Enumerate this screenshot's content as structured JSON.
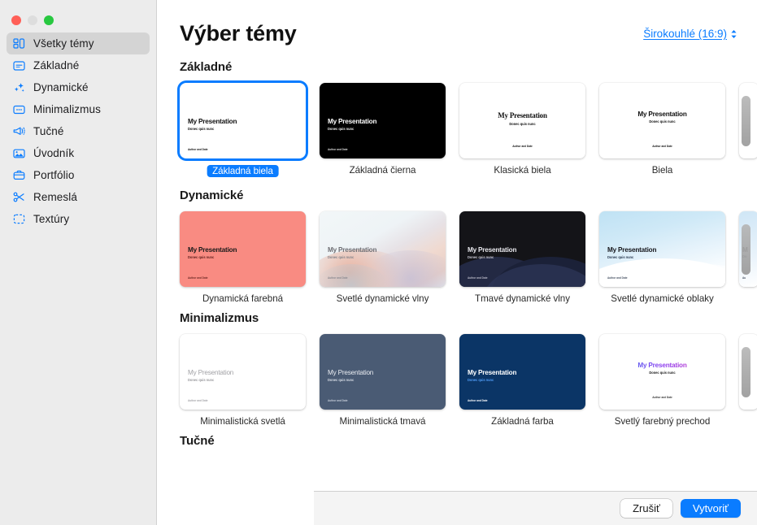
{
  "window": {
    "traffic": [
      "close",
      "minimize",
      "zoom"
    ]
  },
  "sidebar": {
    "items": [
      {
        "label": "Všetky témy",
        "icon": "grid-icon"
      },
      {
        "label": "Základné",
        "icon": "basic-slide-icon"
      },
      {
        "label": "Dynamické",
        "icon": "sparkles-icon"
      },
      {
        "label": "Minimalizmus",
        "icon": "minimal-slide-icon"
      },
      {
        "label": "Tučné",
        "icon": "megaphone-icon"
      },
      {
        "label": "Úvodník",
        "icon": "photo-icon"
      },
      {
        "label": "Portfólio",
        "icon": "briefcase-icon"
      },
      {
        "label": "Remeslá",
        "icon": "scissors-icon"
      },
      {
        "label": "Textúry",
        "icon": "dashed-frame-icon"
      }
    ],
    "selected_index": 0
  },
  "header": {
    "title": "Výber témy",
    "ratio_label": "Širokouhlé (16:9)"
  },
  "slide_text": {
    "title": "My Presentation",
    "subtitle": "Donec quis nunc",
    "author": "Author and Date"
  },
  "sections": [
    {
      "title": "Základné",
      "themes": [
        {
          "name": "Základná biela",
          "style": "basic-white",
          "selected": true
        },
        {
          "name": "Základná čierna",
          "style": "basic-black",
          "selected": false
        },
        {
          "name": "Klasická biela",
          "style": "classic-white",
          "selected": false
        },
        {
          "name": "Biela",
          "style": "white",
          "selected": false
        }
      ]
    },
    {
      "title": "Dynamické",
      "themes": [
        {
          "name": "Dynamická farebná",
          "style": "dyn-color",
          "selected": false
        },
        {
          "name": "Svetlé dynamické vlny",
          "style": "dyn-light-waves",
          "selected": false
        },
        {
          "name": "Tmavé dynamické vlny",
          "style": "dyn-dark-waves",
          "selected": false
        },
        {
          "name": "Svetlé dynamické oblaky",
          "style": "dyn-clouds",
          "selected": false
        }
      ]
    },
    {
      "title": "Minimalizmus",
      "themes": [
        {
          "name": "Minimalistická svetlá",
          "style": "min-light",
          "selected": false
        },
        {
          "name": "Minimalistická tmavá",
          "style": "min-dark",
          "selected": false
        },
        {
          "name": "Základná farba",
          "style": "basic-color",
          "selected": false
        },
        {
          "name": "Svetlý farebný prechod",
          "style": "light-gradient",
          "selected": false
        }
      ]
    },
    {
      "title": "Tučné",
      "themes": []
    }
  ],
  "footer": {
    "cancel_label": "Zrušiť",
    "create_label": "Vytvoriť"
  },
  "colors": {
    "accent": "#0a7cff",
    "sidebar_bg": "#ececec",
    "footer_bg": "#f4f4f4",
    "dyn_color": "#f98b82",
    "min_dark": "#4a5b74",
    "basic_color": "#0b3566",
    "dark_waves": "#141418"
  }
}
